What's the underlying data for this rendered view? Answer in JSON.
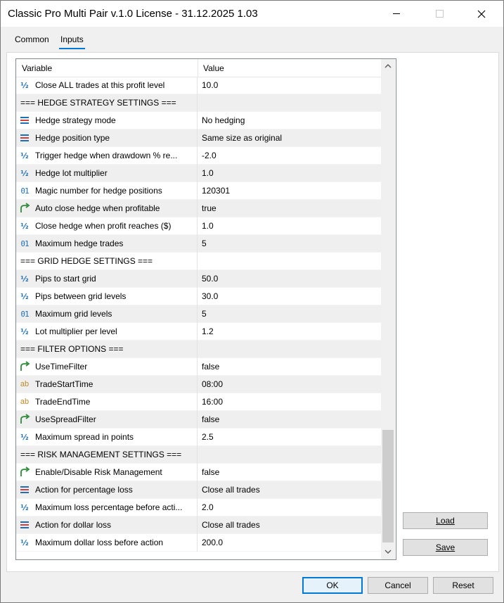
{
  "window": {
    "title": "Classic Pro Multi Pair v.1.0 License - 31.12.2025 1.03"
  },
  "tabs": [
    {
      "label": "Common",
      "active": false
    },
    {
      "label": "Inputs",
      "active": true
    }
  ],
  "grid": {
    "col_variable": "Variable",
    "col_value": "Value",
    "rows": [
      {
        "icon": "fraction-icon",
        "name": "Close ALL trades at this profit level",
        "value": "10.0"
      },
      {
        "icon": "",
        "name": "=== HEDGE STRATEGY SETTINGS ===",
        "value": ""
      },
      {
        "icon": "enum-list-icon",
        "name": "Hedge strategy mode",
        "value": "No hedging"
      },
      {
        "icon": "enum-list-icon",
        "name": "Hedge position type",
        "value": "Same size as original"
      },
      {
        "icon": "fraction-icon",
        "name": "Trigger hedge when drawdown % re...",
        "value": "-2.0"
      },
      {
        "icon": "fraction-icon",
        "name": "Hedge lot multiplier",
        "value": "1.0"
      },
      {
        "icon": "integer-icon",
        "name": "Magic number for hedge positions",
        "value": "120301"
      },
      {
        "icon": "boolean-arrow-icon",
        "name": "Auto close hedge when profitable",
        "value": "true"
      },
      {
        "icon": "fraction-icon",
        "name": "Close hedge when profit reaches ($)",
        "value": "1.0"
      },
      {
        "icon": "integer-icon",
        "name": "Maximum hedge trades",
        "value": "5"
      },
      {
        "icon": "",
        "name": "=== GRID HEDGE SETTINGS ===",
        "value": ""
      },
      {
        "icon": "fraction-icon",
        "name": "Pips to start grid",
        "value": "50.0"
      },
      {
        "icon": "fraction-icon",
        "name": "Pips between grid levels",
        "value": "30.0"
      },
      {
        "icon": "integer-icon",
        "name": "Maximum grid levels",
        "value": "5"
      },
      {
        "icon": "fraction-icon",
        "name": "Lot multiplier per level",
        "value": "1.2"
      },
      {
        "icon": "",
        "name": "=== FILTER OPTIONS ===",
        "value": ""
      },
      {
        "icon": "boolean-arrow-icon",
        "name": "UseTimeFilter",
        "value": "false"
      },
      {
        "icon": "string-ab-icon",
        "name": "TradeStartTime",
        "value": "08:00"
      },
      {
        "icon": "string-ab-icon",
        "name": "TradeEndTime",
        "value": "16:00"
      },
      {
        "icon": "boolean-arrow-icon",
        "name": "UseSpreadFilter",
        "value": "false"
      },
      {
        "icon": "fraction-icon",
        "name": "Maximum spread in points",
        "value": "2.5"
      },
      {
        "icon": "",
        "name": "=== RISK MANAGEMENT SETTINGS ===",
        "value": ""
      },
      {
        "icon": "boolean-arrow-icon",
        "name": "Enable/Disable Risk Management",
        "value": "false"
      },
      {
        "icon": "enum-list-icon",
        "name": "Action for percentage loss",
        "value": "Close all trades"
      },
      {
        "icon": "fraction-icon",
        "name": "Maximum loss percentage before acti...",
        "value": "2.0"
      },
      {
        "icon": "enum-list-icon",
        "name": "Action for dollar loss",
        "value": "Close all trades"
      },
      {
        "icon": "fraction-icon",
        "name": "Maximum dollar loss before action",
        "value": "200.0"
      }
    ]
  },
  "side_buttons": {
    "load": "Load",
    "save": "Save"
  },
  "footer_buttons": {
    "ok": "OK",
    "cancel": "Cancel",
    "reset": "Reset"
  },
  "colors": {
    "accent": "#0078d7",
    "icon_blue": "#1f6fb4",
    "icon_green": "#2e8b3a",
    "icon_orange": "#c08a2c"
  }
}
